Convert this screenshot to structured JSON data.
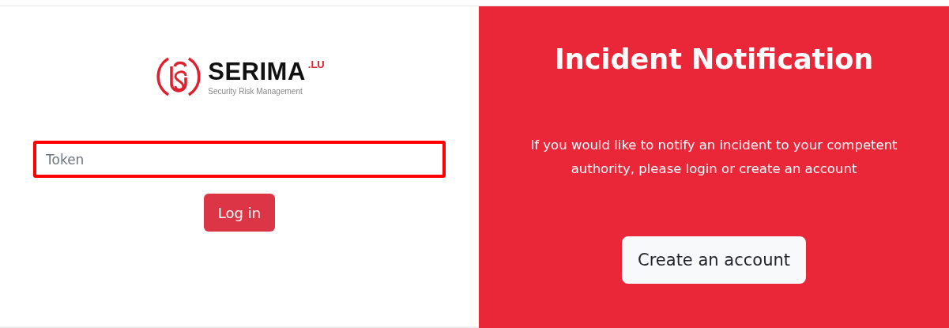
{
  "logo": {
    "name": "SERIMA",
    "suffix": ".LU",
    "tagline": "Security Risk Management"
  },
  "login": {
    "token_field": {
      "placeholder": "Token",
      "focused": true
    },
    "button": "Log in"
  },
  "notification_panel": {
    "title": "Incident Notification",
    "text": "If you would like to notify an incident to your competent authority, please login or create an account",
    "button": "Create an account"
  }
}
